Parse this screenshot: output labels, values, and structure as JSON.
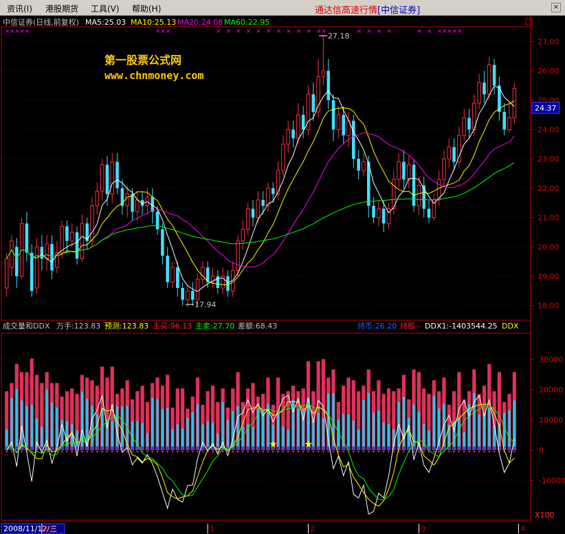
{
  "menu": {
    "items": [
      "资讯(I)",
      "港股期货",
      "工具(V)",
      "帮助(H)"
    ]
  },
  "app_title": {
    "main": "通达信高速行情",
    "broker": "[中信证券]"
  },
  "price_panel": {
    "header": {
      "stock": "中信证券(日线,前复权)",
      "ma5": "MA5:25.03",
      "ma10": "MA10:25.13",
      "ma20": "MA20:24.08",
      "ma60": "MA60:22.95"
    },
    "watermark": {
      "line1": "第一股票公式网",
      "line2": "www.chnmoney.com"
    },
    "high_label": "27.18",
    "low_label": "17.94",
    "current_price": "24.37",
    "yaxis_ticks": [
      "27.00",
      "26.00",
      "25.00",
      "24.00",
      "23.00",
      "22.00",
      "21.00",
      "20.00",
      "19.00",
      "18.00"
    ]
  },
  "ddx_panel": {
    "header": {
      "name": "成交量和DDX",
      "wanshou": "万手:123.83",
      "yuce": "预测:123.83",
      "zhumai_buy": "主买:96.13",
      "zhumai_sell": "主卖:27.70",
      "chae": "差额:68.43",
      "chishi": "持币:26.20",
      "chigu": "持股:-",
      "ddx1": "DDX1:-1403544.25",
      "ddx": "DDX"
    },
    "yaxis_ticks": [
      "30000",
      "20000",
      "10000",
      "0",
      "-10000"
    ],
    "unit": "X100"
  },
  "date_axis": {
    "current_date": "2008/11/12/三",
    "months": [
      "12",
      "1",
      "2",
      "3",
      "4"
    ]
  },
  "colors": {
    "up": "#ff3040",
    "down": "#40e0ff",
    "ma5": "#ffffff",
    "ma10": "#ffff00",
    "ma20": "#ff00ff",
    "ma60": "#00ff00",
    "axis": "#c00000"
  },
  "chart_data": {
    "type": "candlestick",
    "ylim": [
      17.5,
      27.5
    ],
    "candles": [
      [
        18.6,
        19.6,
        18.3,
        19.8
      ],
      [
        19.3,
        20.2,
        19.0,
        20.4
      ],
      [
        20.0,
        19.0,
        18.6,
        20.3
      ],
      [
        19.0,
        20.8,
        18.9,
        21.0
      ],
      [
        20.8,
        19.8,
        19.5,
        21.2
      ],
      [
        19.8,
        18.5,
        18.3,
        20.1
      ],
      [
        18.6,
        20.0,
        18.4,
        20.3
      ],
      [
        20.0,
        19.6,
        19.2,
        20.4
      ],
      [
        19.6,
        20.1,
        19.2,
        20.4
      ],
      [
        20.1,
        19.2,
        18.9,
        20.4
      ],
      [
        19.3,
        19.8,
        19.1,
        20.2
      ],
      [
        19.8,
        20.7,
        19.6,
        20.9
      ],
      [
        20.7,
        20.2,
        19.8,
        20.9
      ],
      [
        20.2,
        20.5,
        20.0,
        20.8
      ],
      [
        20.5,
        19.6,
        19.4,
        20.7
      ],
      [
        19.6,
        20.8,
        19.5,
        21.1
      ],
      [
        20.8,
        20.2,
        19.9,
        21.0
      ],
      [
        20.2,
        21.4,
        20.0,
        21.7
      ],
      [
        21.4,
        21.9,
        21.1,
        22.2
      ],
      [
        21.9,
        22.8,
        21.6,
        23.0
      ],
      [
        22.8,
        21.8,
        21.4,
        23.1
      ],
      [
        21.8,
        22.9,
        21.5,
        23.2
      ],
      [
        22.9,
        22.0,
        21.8,
        23.2
      ],
      [
        22.0,
        21.4,
        21.1,
        22.3
      ],
      [
        21.4,
        21.8,
        21.0,
        22.1
      ],
      [
        21.8,
        21.2,
        20.9,
        22.0
      ],
      [
        21.2,
        21.6,
        20.9,
        21.9
      ],
      [
        21.6,
        21.4,
        21.1,
        21.9
      ],
      [
        21.4,
        21.7,
        21.1,
        22.0
      ],
      [
        21.7,
        21.2,
        20.8,
        22.0
      ],
      [
        21.2,
        20.6,
        20.4,
        21.4
      ],
      [
        20.6,
        19.7,
        19.4,
        20.8
      ],
      [
        19.7,
        18.8,
        18.6,
        20.0
      ],
      [
        18.8,
        19.3,
        18.6,
        19.5
      ],
      [
        19.3,
        18.6,
        18.3,
        19.5
      ],
      [
        18.6,
        18.2,
        18.0,
        18.8
      ],
      [
        18.2,
        18.5,
        17.94,
        18.7
      ],
      [
        18.5,
        18.2,
        18.0,
        18.8
      ],
      [
        18.2,
        18.9,
        18.0,
        19.1
      ],
      [
        18.9,
        19.3,
        18.7,
        19.5
      ],
      [
        19.3,
        18.8,
        18.6,
        19.5
      ],
      [
        18.8,
        19.0,
        18.6,
        19.3
      ],
      [
        19.0,
        18.6,
        18.4,
        19.2
      ],
      [
        18.6,
        19.0,
        18.4,
        19.3
      ],
      [
        19.0,
        18.5,
        18.3,
        19.2
      ],
      [
        18.5,
        19.2,
        18.3,
        19.5
      ],
      [
        19.2,
        20.2,
        19.0,
        20.4
      ],
      [
        20.2,
        20.6,
        19.9,
        20.9
      ],
      [
        20.6,
        21.3,
        20.4,
        21.5
      ],
      [
        21.3,
        21.0,
        20.7,
        21.6
      ],
      [
        21.0,
        21.6,
        20.8,
        21.9
      ],
      [
        21.6,
        21.4,
        21.1,
        21.9
      ],
      [
        21.4,
        22.0,
        21.2,
        22.2
      ],
      [
        22.0,
        21.8,
        21.5,
        22.2
      ],
      [
        21.8,
        22.6,
        21.6,
        22.9
      ],
      [
        22.6,
        23.5,
        22.4,
        23.8
      ],
      [
        23.5,
        24.0,
        23.2,
        24.3
      ],
      [
        24.0,
        23.7,
        23.4,
        24.3
      ],
      [
        23.7,
        24.5,
        23.5,
        24.9
      ],
      [
        24.5,
        24.0,
        23.7,
        24.8
      ],
      [
        24.0,
        25.2,
        23.8,
        25.5
      ],
      [
        25.2,
        24.6,
        24.3,
        25.6
      ],
      [
        24.6,
        25.8,
        24.4,
        26.4
      ],
      [
        25.8,
        26.0,
        25.5,
        27.18
      ],
      [
        26.0,
        25.0,
        24.7,
        26.4
      ],
      [
        25.0,
        24.0,
        23.6,
        25.2
      ],
      [
        24.0,
        24.5,
        23.7,
        24.8
      ],
      [
        24.5,
        23.8,
        23.5,
        24.8
      ],
      [
        23.8,
        24.3,
        23.4,
        24.6
      ],
      [
        24.3,
        23.0,
        22.7,
        24.5
      ],
      [
        23.0,
        22.6,
        22.3,
        23.3
      ],
      [
        22.6,
        22.9,
        22.4,
        23.2
      ],
      [
        22.9,
        21.4,
        21.0,
        23.1
      ],
      [
        21.4,
        21.0,
        20.8,
        21.7
      ],
      [
        21.0,
        21.3,
        20.7,
        21.6
      ],
      [
        21.3,
        20.8,
        20.5,
        21.6
      ],
      [
        20.8,
        21.3,
        20.6,
        21.5
      ],
      [
        21.3,
        22.3,
        21.1,
        22.6
      ],
      [
        22.3,
        22.9,
        22.0,
        23.2
      ],
      [
        22.9,
        22.3,
        22.0,
        23.3
      ],
      [
        22.3,
        22.8,
        22.0,
        23.1
      ],
      [
        22.8,
        21.4,
        21.2,
        23.0
      ],
      [
        21.4,
        22.1,
        21.1,
        22.4
      ],
      [
        22.1,
        21.3,
        21.0,
        22.4
      ],
      [
        21.3,
        21.0,
        20.8,
        21.6
      ],
      [
        21.0,
        21.6,
        20.9,
        21.8
      ],
      [
        21.6,
        22.3,
        21.4,
        22.6
      ],
      [
        22.3,
        23.0,
        22.0,
        23.3
      ],
      [
        23.0,
        23.4,
        22.7,
        23.7
      ],
      [
        23.4,
        22.9,
        22.6,
        23.7
      ],
      [
        22.9,
        23.8,
        22.7,
        24.1
      ],
      [
        23.8,
        24.4,
        23.6,
        24.7
      ],
      [
        24.4,
        24.0,
        23.7,
        24.7
      ],
      [
        24.0,
        24.9,
        23.8,
        25.2
      ],
      [
        24.9,
        25.6,
        24.7,
        25.9
      ],
      [
        25.6,
        25.2,
        24.9,
        26.0
      ],
      [
        25.2,
        26.2,
        25.0,
        26.5
      ],
      [
        26.2,
        25.5,
        25.2,
        26.4
      ],
      [
        25.5,
        24.6,
        24.3,
        25.8
      ],
      [
        24.6,
        24.0,
        23.8,
        24.9
      ],
      [
        24.0,
        24.4,
        23.9,
        24.9
      ],
      [
        24.4,
        25.4,
        24.2,
        25.6
      ]
    ]
  }
}
